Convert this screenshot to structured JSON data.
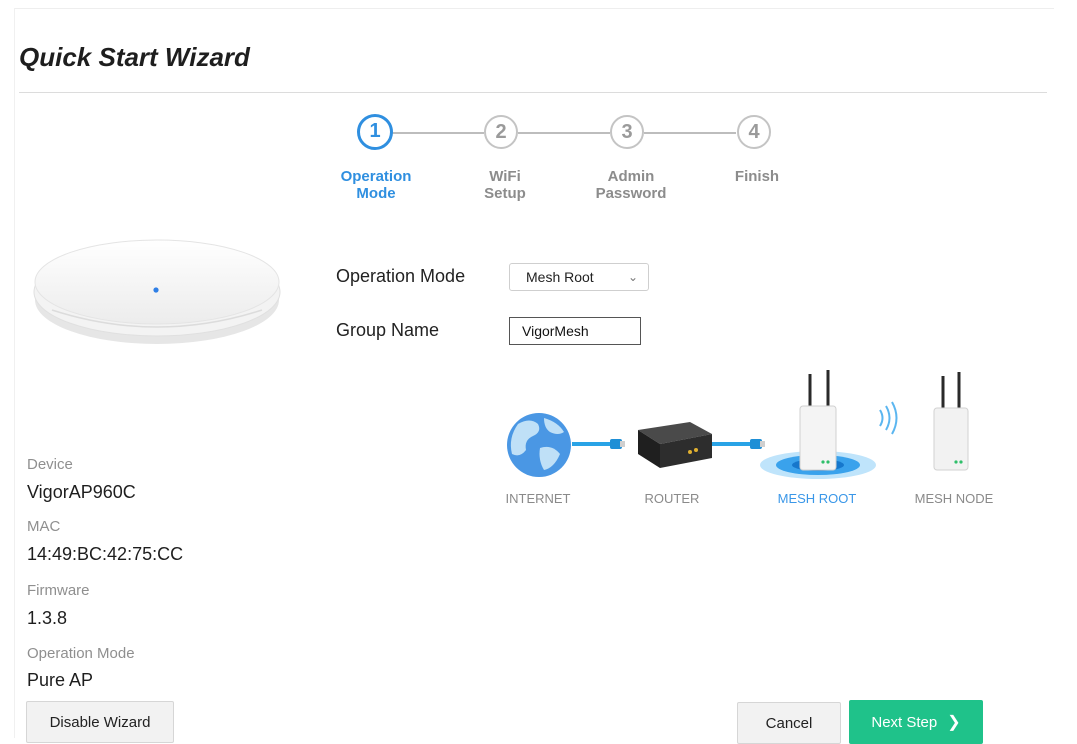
{
  "page": {
    "title": "Quick Start Wizard"
  },
  "steps": [
    {
      "number": "1",
      "label": "Operation\nMode",
      "active": true
    },
    {
      "number": "2",
      "label": "WiFi\nSetup",
      "active": false
    },
    {
      "number": "3",
      "label": "Admin\nPassword",
      "active": false
    },
    {
      "number": "4",
      "label": "Finish",
      "active": false
    }
  ],
  "form": {
    "operation_mode_label": "Operation Mode",
    "operation_mode_value": "Mesh Root",
    "group_name_label": "Group Name",
    "group_name_value": "VigorMesh"
  },
  "diagram": {
    "internet": "INTERNET",
    "router": "ROUTER",
    "mesh_root": "MESH ROOT",
    "mesh_node": "MESH NODE"
  },
  "device_info": {
    "device_label": "Device",
    "device_value": "VigorAP960C",
    "mac_label": "MAC",
    "mac_value": "14:49:BC:42:75:CC",
    "firmware_label": "Firmware",
    "firmware_value": "1.3.8",
    "mode_label": "Operation Mode",
    "mode_value": "Pure AP"
  },
  "buttons": {
    "disable_wizard": "Disable Wizard",
    "cancel": "Cancel",
    "next_step": "Next Step"
  },
  "colors": {
    "accent": "#2f8fe0",
    "primary_button": "#1fc28a",
    "cable": "#29a3e6"
  },
  "icons": {
    "dropdown": "chevron-down-icon",
    "next": "chevron-right-icon"
  }
}
